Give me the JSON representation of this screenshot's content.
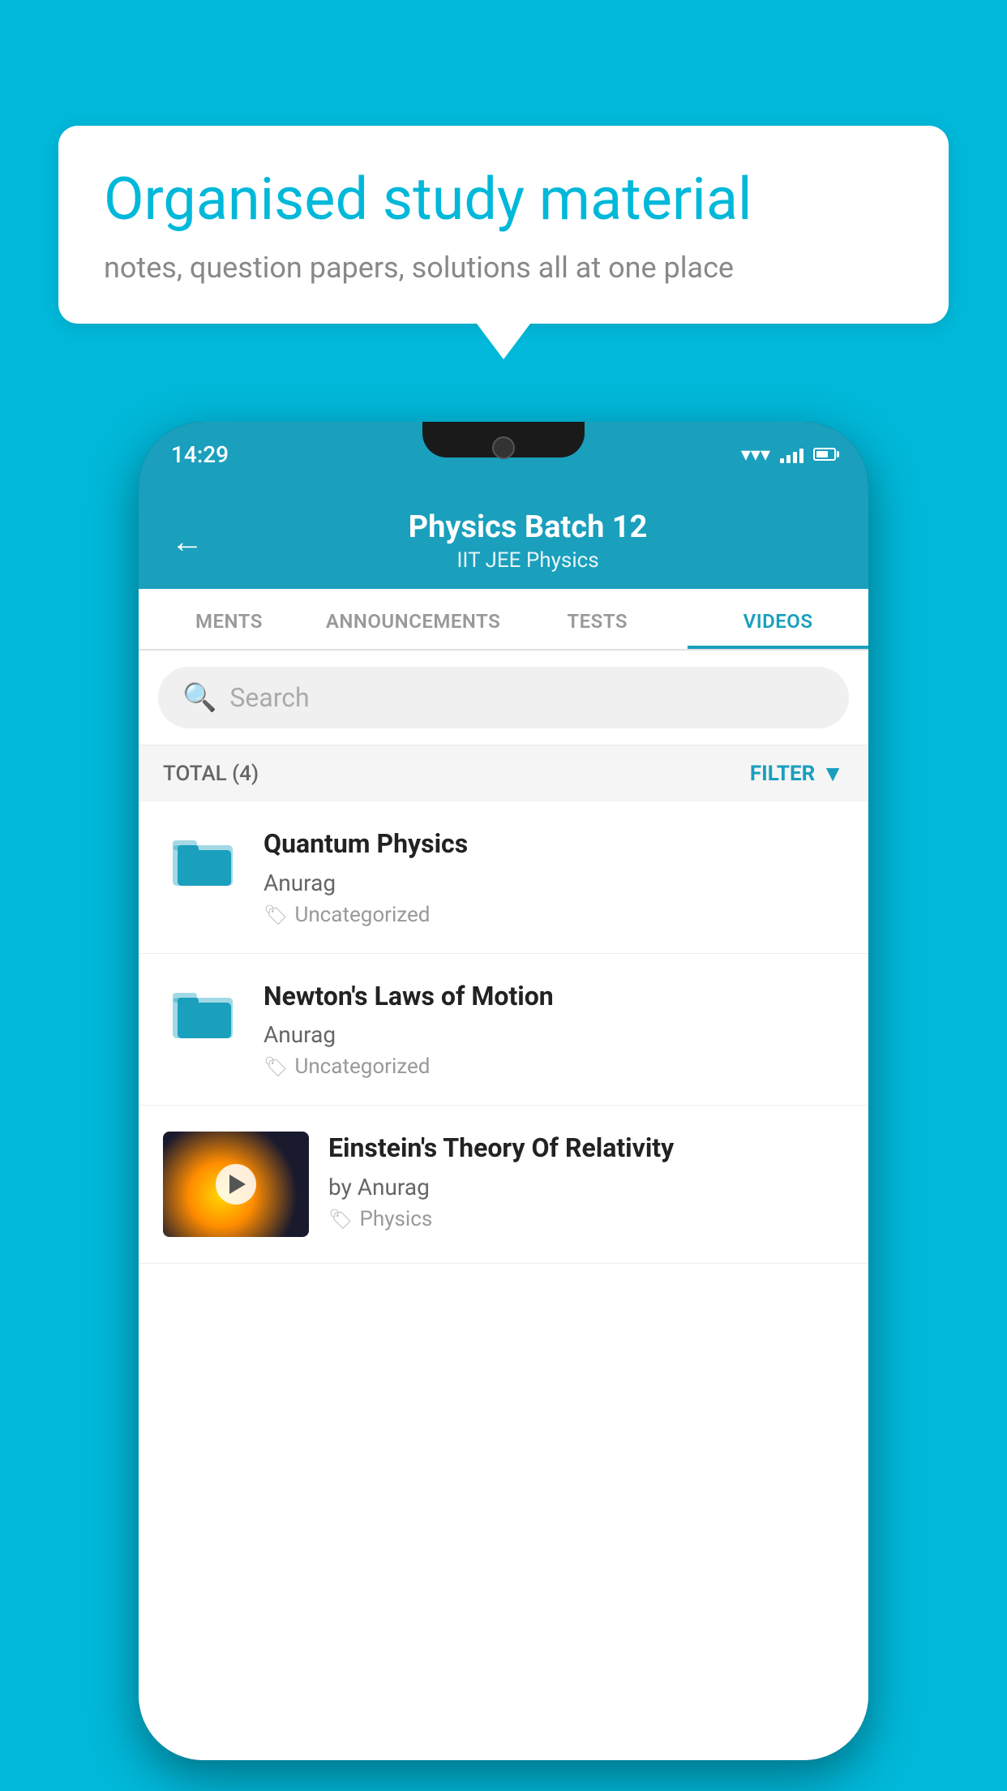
{
  "background_color": "#00b8d9",
  "speech_bubble": {
    "title": "Organised study material",
    "subtitle": "notes, question papers, solutions all at one place"
  },
  "phone": {
    "status_bar": {
      "time": "14:29"
    },
    "header": {
      "title": "Physics Batch 12",
      "subtitle": "IIT JEE   Physics",
      "back_label": "←"
    },
    "tabs": [
      {
        "label": "MENTS",
        "active": false
      },
      {
        "label": "ANNOUNCEMENTS",
        "active": false
      },
      {
        "label": "TESTS",
        "active": false
      },
      {
        "label": "VIDEOS",
        "active": true
      }
    ],
    "search": {
      "placeholder": "Search"
    },
    "filter": {
      "total_label": "TOTAL (4)",
      "filter_label": "FILTER"
    },
    "videos": [
      {
        "id": 1,
        "title": "Quantum Physics",
        "author": "Anurag",
        "tag": "Uncategorized",
        "has_thumbnail": false
      },
      {
        "id": 2,
        "title": "Newton's Laws of Motion",
        "author": "Anurag",
        "tag": "Uncategorized",
        "has_thumbnail": false
      },
      {
        "id": 3,
        "title": "Einstein's Theory Of Relativity",
        "author": "by Anurag",
        "tag": "Physics",
        "has_thumbnail": true
      }
    ]
  }
}
